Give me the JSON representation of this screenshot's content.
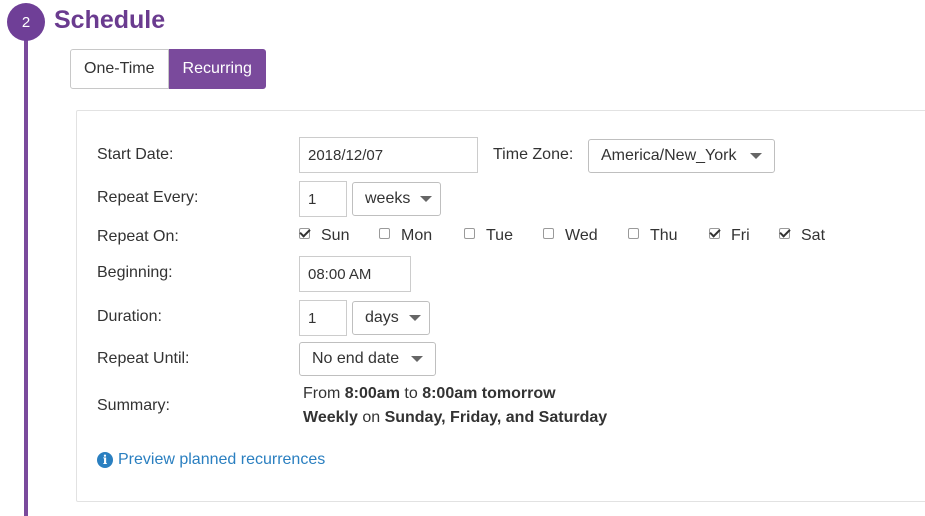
{
  "step": {
    "number": "2",
    "title": "Schedule"
  },
  "mode_tabs": [
    {
      "label": "One-Time",
      "active": false
    },
    {
      "label": "Recurring",
      "active": true
    }
  ],
  "form": {
    "start_date": {
      "label": "Start Date:",
      "value": "2018/12/07"
    },
    "time_zone": {
      "label": "Time Zone:",
      "value": "America/New_York"
    },
    "repeat_every": {
      "label": "Repeat Every:",
      "count": "1",
      "unit": "weeks"
    },
    "repeat_on": {
      "label": "Repeat On:",
      "days": [
        {
          "label": "Sun",
          "checked": true
        },
        {
          "label": "Mon",
          "checked": false
        },
        {
          "label": "Tue",
          "checked": false
        },
        {
          "label": "Wed",
          "checked": false
        },
        {
          "label": "Thu",
          "checked": false
        },
        {
          "label": "Fri",
          "checked": true
        },
        {
          "label": "Sat",
          "checked": true
        }
      ]
    },
    "beginning": {
      "label": "Beginning:",
      "value": "08:00 AM"
    },
    "duration": {
      "label": "Duration:",
      "count": "1",
      "unit": "days"
    },
    "repeat_until": {
      "label": "Repeat Until:",
      "value": "No end date"
    },
    "summary": {
      "label": "Summary:",
      "line1": {
        "from_word": "From",
        "start": "8:00am",
        "to_word": "to",
        "end": "8:00am tomorrow"
      },
      "line2": {
        "frequency": "Weekly",
        "on_word": "on",
        "days": "Sunday, Friday, and Saturday"
      }
    }
  },
  "preview_link": "Preview planned recurrences",
  "colors": {
    "accent": "#7a4a9c",
    "link": "#2a7fc0"
  }
}
